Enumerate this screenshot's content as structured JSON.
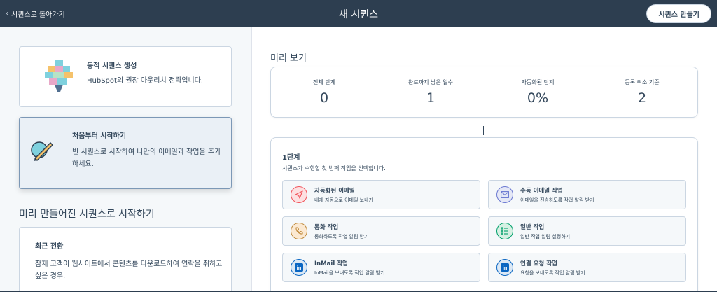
{
  "topbar": {
    "back_label": "시퀀스로 돌아가기",
    "title": "새 시퀀스",
    "create_button": "시퀀스 만들기"
  },
  "left": {
    "dynamic_card": {
      "title": "동적 시퀀스 생성",
      "description": "HubSpot의 권장 아웃리치 전략입니다."
    },
    "scratch_card": {
      "title": "처음부터 시작하기",
      "description": "빈 시퀀스로 시작하여 나만의 이메일과 작업을 추가하세요."
    },
    "templates_heading": "미리 만들어진 시퀀스로 시작하기",
    "recent_card": {
      "title": "최근 전환",
      "description": "잠재 고객이 웹사이트에서 콘텐츠를 다운로드하여 연락을 취하고 싶은 경우."
    }
  },
  "preview": {
    "heading": "미리 보기",
    "stats": [
      {
        "label": "전체 단계",
        "value": "0"
      },
      {
        "label": "완료까지 남은 일수",
        "value": "1"
      },
      {
        "label": "자동화된 단계",
        "value": "0%"
      },
      {
        "label": "등록 취소 기준",
        "value": "2"
      }
    ],
    "step": {
      "title": "1단계",
      "description": "시퀀스가 수행할 첫 번째 작업을 선택합니다.",
      "actions": [
        {
          "title": "자동화된 이메일",
          "subtitle": "내게 자동으로 이메일 보내기",
          "icon": "paper-plane-icon",
          "color": "#f2545b",
          "bg": "#fde0e1"
        },
        {
          "title": "수동 이메일 작업",
          "subtitle": "이메일을 전송하도록 작업 알림 받기",
          "icon": "envelope-icon",
          "color": "#6a78d1",
          "bg": "#e5e8f6"
        },
        {
          "title": "통화 작업",
          "subtitle": "통화하도록 작업 알림 받기",
          "icon": "phone-icon",
          "color": "#c08b3e",
          "bg": "#fbe9d2"
        },
        {
          "title": "일반 작업",
          "subtitle": "일반 작업 알림 설정하기",
          "icon": "checklist-icon",
          "color": "#00a06b",
          "bg": "#d6f0e3"
        },
        {
          "title": "InMail 작업",
          "subtitle": "InMail을 보내도록 작업 알림 받기",
          "icon": "linkedin-icon",
          "color": "#0a66c2",
          "bg": "#dbe8f5"
        },
        {
          "title": "연결 요청 작업",
          "subtitle": "요청을 보내도록 작업 알림 받기",
          "icon": "linkedin-icon",
          "color": "#0a66c2",
          "bg": "#dbe8f5"
        }
      ]
    }
  }
}
